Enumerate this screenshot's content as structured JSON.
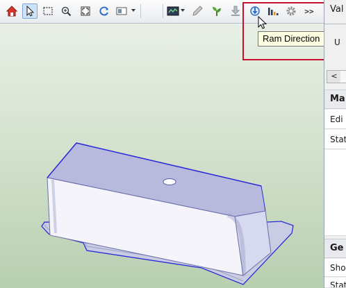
{
  "toolbar": {
    "buttons": [
      {
        "icon": "home-icon"
      },
      {
        "icon": "select-arrow-icon",
        "active": true
      },
      {
        "icon": "box-select-icon"
      },
      {
        "icon": "zoom-icon"
      },
      {
        "icon": "fit-view-icon"
      },
      {
        "icon": "rotate-icon"
      },
      {
        "icon": "view-layout-icon"
      },
      {
        "icon": "chart-monitor-icon"
      },
      {
        "icon": "pencil-icon"
      },
      {
        "icon": "plant-icon"
      },
      {
        "icon": "download-icon"
      },
      {
        "icon": "ram-direction-icon"
      },
      {
        "icon": "bar-chart-icon"
      },
      {
        "icon": "settings-gear-icon"
      }
    ],
    "more_label": ">>"
  },
  "tooltip": {
    "text": "Ram Direction"
  },
  "panel": {
    "top_label": "Val",
    "sub_label": "U",
    "scroll_left": "<",
    "section1_title": "Ma",
    "section1_rows": [
      "Edi",
      "Stat"
    ],
    "section2_title": "Ge",
    "section2_rows": [
      "Sho",
      "Stat"
    ]
  },
  "colors": {
    "highlight_box": "#c8102e",
    "part_fill": "#c9cce3",
    "part_edge": "#2a2ad8",
    "viewport_top": "#e9efe6",
    "viewport_bottom": "#b8cfb0"
  }
}
